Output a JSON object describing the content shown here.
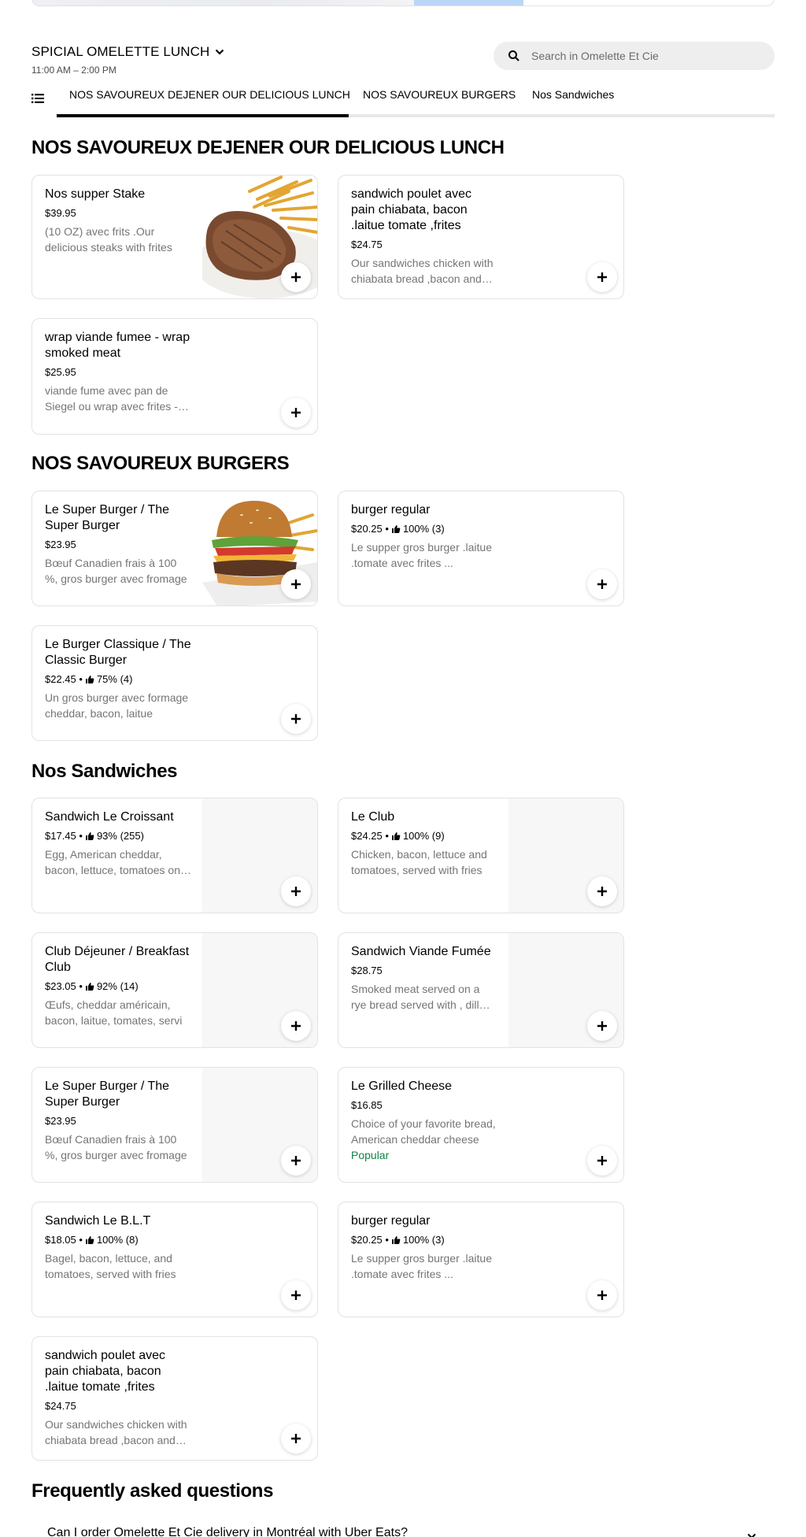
{
  "menu": {
    "title": "SPICIAL OMELETTE LUNCH",
    "hours": "11:00 AM – 2:00 PM"
  },
  "search": {
    "placeholder": "Search in Omelette Et Cie"
  },
  "tabs": [
    {
      "label": "NOS SAVOUREUX DEJENER OUR DELICIOUS LUNCH",
      "active": true
    },
    {
      "label": "NOS SAVOUREUX BURGERS",
      "active": false
    },
    {
      "label": "Nos Sandwiches",
      "active": false
    }
  ],
  "sections": [
    {
      "title": "NOS SAVOUREUX DEJENER OUR DELICIOUS LUNCH",
      "items": [
        {
          "name": "Nos supper Stake",
          "meta": "$39.95",
          "desc": "(10 OZ) avec frits .Our delicious steaks with frites",
          "image": "steak-frites"
        },
        {
          "name": "sandwich poulet avec pain chiabata, bacon .laitue tomate ,frites",
          "meta": "$24.75",
          "desc": "Our sandwiches  chicken with chiabata bread ,bacon and fries"
        },
        {
          "name": "wrap viande fumee - wrap smoked meat",
          "meta": "$25.95",
          "desc": "viande fume avec pan  de Siegel ou wrap avec frites - smoked meat"
        }
      ]
    },
    {
      "title": "NOS SAVOUREUX BURGERS",
      "items": [
        {
          "name": "Le Super Burger / The Super Burger",
          "meta": "$23.95",
          "desc": "Bœuf Canadien frais à 100 %, gros burger avec fromage",
          "image": "burger"
        },
        {
          "name": "burger regular",
          "meta": "$20.25 •",
          "rating": "100% (3)",
          "desc": "Le supper gros burger .laitue  .tomate  avec  frites  ..."
        },
        {
          "name": "Le Burger Classique / The Classic Burger",
          "meta": "$22.45 •",
          "rating": "75% (4)",
          "desc": "Un gros burger avec formage cheddar, bacon, laitue"
        }
      ]
    },
    {
      "title": "Nos Sandwiches",
      "items": [
        {
          "name": "Sandwich Le Croissant",
          "meta": "$17.45 •",
          "rating": "93% (255)",
          "desc": "Egg, American cheddar, bacon, lettuce, tomatoes on a croissant",
          "image": "blank"
        },
        {
          "name": "Le Club",
          "meta": "$24.25 •",
          "rating": "100% (9)",
          "desc": "Chicken, bacon, lettuce and tomatoes, served with fries",
          "image": "blank"
        },
        {
          "name": "Club Déjeuner / Breakfast Club",
          "meta": "$23.05 •",
          "rating": "92% (14)",
          "desc": "Œufs, cheddar américain, bacon, laitue, tomates, servi",
          "image": "blank"
        },
        {
          "name": "Sandwich Viande Fumée",
          "meta": "$28.75",
          "desc": "Smoked meat served on a rye bread served with , dill pickle",
          "image": "blank"
        },
        {
          "name": "Le Super Burger / The Super Burger",
          "meta": "$23.95",
          "desc": "Bœuf Canadien frais à 100 %, gros burger avec fromage",
          "image": "blank"
        },
        {
          "name": "Le Grilled Cheese",
          "meta": "$16.85",
          "desc": "Choice of your favorite bread, American cheddar cheese",
          "popular": "Popular"
        },
        {
          "name": "Sandwich Le B.L.T",
          "meta": "$18.05 •",
          "rating": "100% (8)",
          "desc": "Bagel, bacon, lettuce, and tomatoes, served with fries"
        },
        {
          "name": "burger regular",
          "meta": "$20.25 •",
          "rating": "100% (3)",
          "desc": "Le supper gros burger .laitue  .tomate  avec  frites  ..."
        },
        {
          "name": "sandwich poulet avec pain chiabata, bacon .laitue tomate ,frites",
          "meta": "$24.75",
          "desc": "Our sandwiches  chicken with chiabata bread ,bacon and fries"
        }
      ]
    }
  ],
  "faq": {
    "title": "Frequently asked questions",
    "first_question": "Can I order Omelette Et Cie delivery in Montréal with Uber Eats?"
  }
}
